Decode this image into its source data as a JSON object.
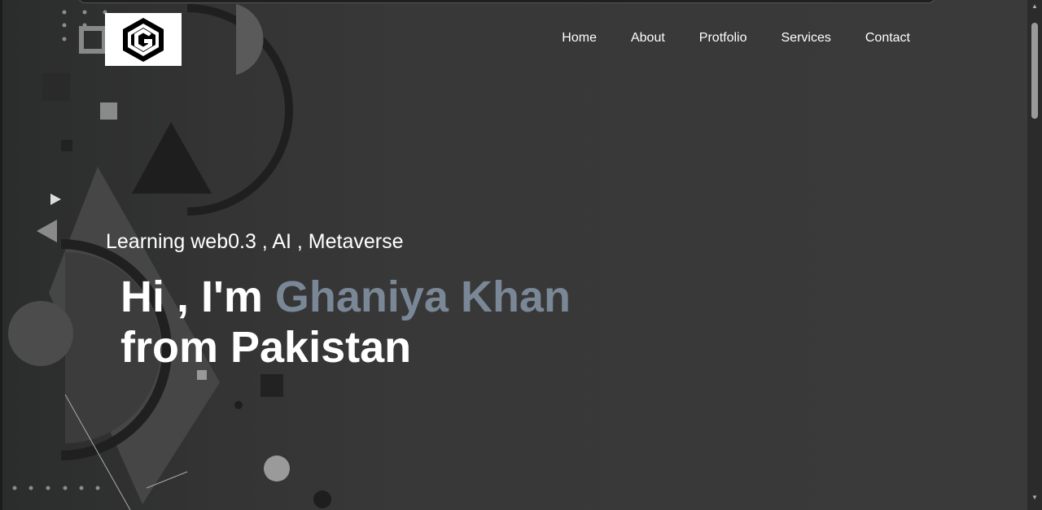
{
  "logo": {
    "alt": "G logo",
    "icon": "hexagon-g-logo"
  },
  "nav": {
    "items": [
      {
        "label": "Home"
      },
      {
        "label": "About"
      },
      {
        "label": "Protfolio"
      },
      {
        "label": "Services"
      },
      {
        "label": "Contact"
      }
    ]
  },
  "hero": {
    "tagline": "Learning web0.3 , AI , Metaverse",
    "greeting": "Hi , I'm ",
    "name": "Ghaniya Khan",
    "origin": "from Pakistan"
  },
  "colors": {
    "background": "#383838",
    "name_accent": "#7a8796",
    "text": "#ffffff"
  }
}
